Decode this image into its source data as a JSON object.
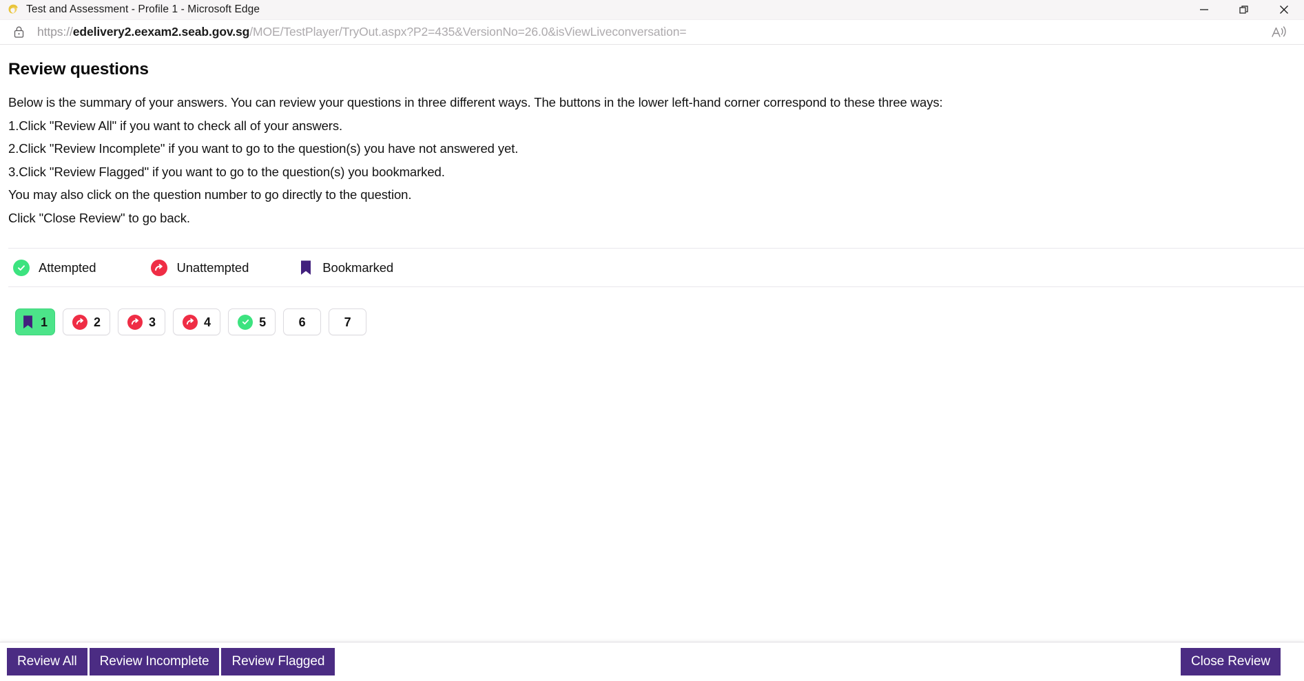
{
  "window": {
    "title": "Test and Assessment - Profile 1 - Microsoft Edge",
    "app_icon": "edge-logo-icon",
    "controls": {
      "minimize": "minimize-icon",
      "restore": "restore-icon",
      "close": "close-icon"
    }
  },
  "address_bar": {
    "lock_icon": "lock-icon",
    "url_scheme": "https://",
    "url_host": "edelivery2.eexam2.seab.gov.sg",
    "url_path": "/MOE/TestPlayer/TryOut.aspx?P2=435&VersionNo=26.0&isViewLiveconversation=",
    "read_aloud_icon": "read-aloud-icon"
  },
  "main": {
    "title": "Review questions",
    "instructions": [
      "Below is the summary of your answers. You can review your questions in three different ways. The buttons in the lower left-hand corner correspond to these three ways:",
      "1.Click \"Review All\" if you want to check all of your answers.",
      "2.Click \"Review Incomplete\" if you want to go to the question(s) you have not answered yet.",
      "3.Click \"Review Flagged\" if you want to go to the question(s) you bookmarked.",
      "You may also click on the question number to go directly to the question.",
      "Click \"Close Review\" to go back."
    ],
    "legend": [
      {
        "status": "attempted",
        "icon": "check-circle-icon",
        "label": "Attempted",
        "color": "#3ce37f"
      },
      {
        "status": "unattempted",
        "icon": "arrow-circle-icon",
        "label": "Unattempted",
        "color": "#ef2d45"
      },
      {
        "status": "bookmarked",
        "icon": "bookmark-icon",
        "label": "Bookmarked",
        "color": "#42207d"
      }
    ],
    "questions": [
      {
        "number": "1",
        "status": "bookmarked",
        "flagged": true
      },
      {
        "number": "2",
        "status": "unattempted",
        "flagged": false
      },
      {
        "number": "3",
        "status": "unattempted",
        "flagged": false
      },
      {
        "number": "4",
        "status": "unattempted",
        "flagged": false
      },
      {
        "number": "5",
        "status": "attempted",
        "flagged": false
      },
      {
        "number": "6",
        "status": "none",
        "flagged": false
      },
      {
        "number": "7",
        "status": "none",
        "flagged": false
      }
    ]
  },
  "footer": {
    "review_all_label": "Review All",
    "review_incomplete_label": "Review Incomplete",
    "review_flagged_label": "Review Flagged",
    "close_review_label": "Close Review",
    "button_color": "#4b2c83"
  }
}
